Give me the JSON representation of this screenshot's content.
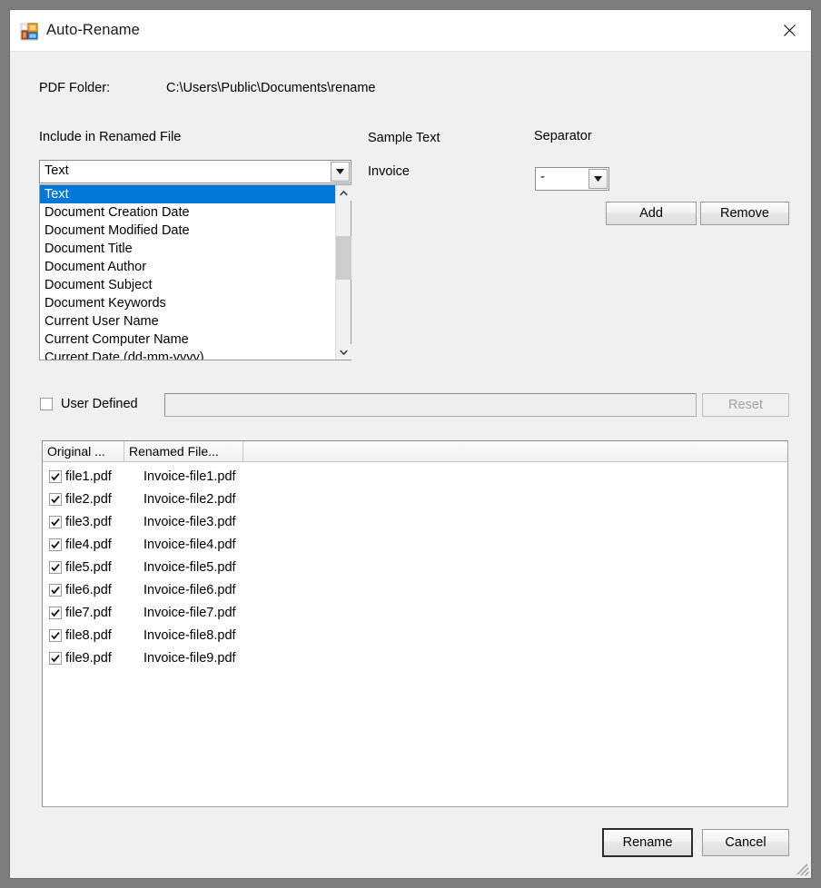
{
  "window": {
    "title": "Auto-Rename",
    "icon": "form-icon",
    "close_icon": "close-icon"
  },
  "folder": {
    "label": "PDF Folder:",
    "path": "C:\\Users\\Public\\Documents\\rename"
  },
  "include_section": {
    "label": "Include in Renamed File",
    "combo_value": "Text",
    "options": [
      "Text",
      "Document Creation Date",
      "Document Modified Date",
      "Document Title",
      "Document Author",
      "Document Subject",
      "Document Keywords",
      "Current User Name",
      "Current Computer Name",
      "Current Date (dd-mm-yyyy)"
    ],
    "selected_index": 0
  },
  "sample": {
    "label": "Sample Text",
    "value": "Invoice"
  },
  "separator": {
    "label": "Separator",
    "value": "-"
  },
  "actions": {
    "add_label": "Add",
    "remove_label": "Remove",
    "reset_label": "Reset",
    "rename_label": "Rename",
    "cancel_label": "Cancel"
  },
  "user_defined": {
    "label": "User Defined",
    "checked": false,
    "input_value": "",
    "input_enabled": false
  },
  "listview": {
    "columns": [
      "Original ...",
      "Renamed File..."
    ],
    "rows": [
      {
        "checked": true,
        "original": "file1.pdf",
        "renamed": "Invoice-file1.pdf"
      },
      {
        "checked": true,
        "original": "file2.pdf",
        "renamed": "Invoice-file2.pdf"
      },
      {
        "checked": true,
        "original": "file3.pdf",
        "renamed": "Invoice-file3.pdf"
      },
      {
        "checked": true,
        "original": "file4.pdf",
        "renamed": "Invoice-file4.pdf"
      },
      {
        "checked": true,
        "original": "file5.pdf",
        "renamed": "Invoice-file5.pdf"
      },
      {
        "checked": true,
        "original": "file6.pdf",
        "renamed": "Invoice-file6.pdf"
      },
      {
        "checked": true,
        "original": "file7.pdf",
        "renamed": "Invoice-file7.pdf"
      },
      {
        "checked": true,
        "original": "file8.pdf",
        "renamed": "Invoice-file8.pdf"
      },
      {
        "checked": true,
        "original": "file9.pdf",
        "renamed": "Invoice-file9.pdf"
      }
    ]
  },
  "colors": {
    "selection": "#0078d7",
    "window_bg": "#f0f0f0",
    "desktop": "#7d7d7d"
  }
}
